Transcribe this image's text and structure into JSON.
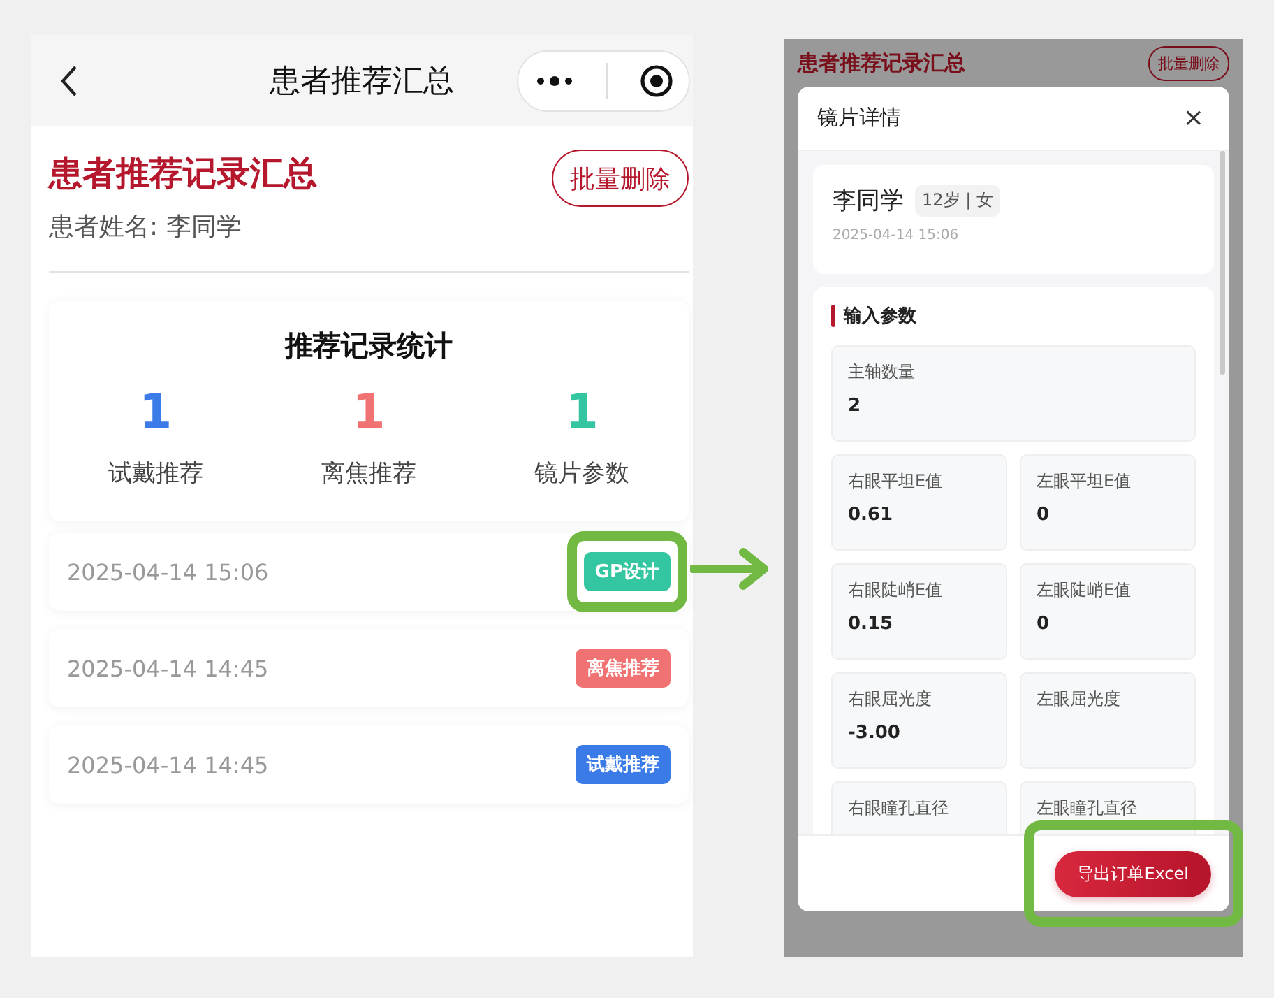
{
  "nav_bar": {
    "title": "患者推荐汇总"
  },
  "header": {
    "title": "患者推荐记录汇总",
    "patient_name": "患者姓名: 李同学",
    "batch_delete": "批量删除"
  },
  "stats": {
    "title": "推荐记录统计",
    "items": [
      {
        "value": "1",
        "label": "试戴推荐",
        "color": "#3b7be8"
      },
      {
        "value": "1",
        "label": "离焦推荐",
        "color": "#f07272"
      },
      {
        "value": "1",
        "label": "镜片参数",
        "color": "#33c6a0"
      }
    ]
  },
  "records": [
    {
      "time": "2025-04-14 15:06",
      "tag": "GP设计",
      "color": "#33c6a0",
      "highlighted": true
    },
    {
      "time": "2025-04-14 14:45",
      "tag": "离焦推荐",
      "color": "#f07272",
      "highlighted": false
    },
    {
      "time": "2025-04-14 14:45",
      "tag": "试戴推荐",
      "color": "#3b7be8",
      "highlighted": false
    }
  ],
  "detail_screen": {
    "background": {
      "title": "患者推荐记录汇总",
      "batch_delete": "批量删除"
    },
    "modal": {
      "title": "镜片详情",
      "close": "×",
      "patient": {
        "name": "李同学",
        "info": "12岁 | 女",
        "time": "2025-04-14 15:06"
      },
      "section_title": "输入参数",
      "params": [
        {
          "kind": "full",
          "label": "主轴数量",
          "value": "2"
        },
        {
          "kind": "half",
          "label": "右眼平坦E值",
          "value": "0.61"
        },
        {
          "kind": "half",
          "label": "左眼平坦E值",
          "value": "0"
        },
        {
          "kind": "half",
          "label": "右眼陡峭E值",
          "value": "0.15"
        },
        {
          "kind": "half",
          "label": "左眼陡峭E值",
          "value": "0"
        },
        {
          "kind": "half",
          "label": "右眼屈光度",
          "value": "-3.00"
        },
        {
          "kind": "half",
          "label": "左眼屈光度"
        },
        {
          "kind": "half",
          "label": "右眼瞳孔直径"
        },
        {
          "kind": "half",
          "label": "左眼瞳孔直径"
        }
      ],
      "export_button": "导出订单Excel",
      "export_highlighted": true
    }
  }
}
